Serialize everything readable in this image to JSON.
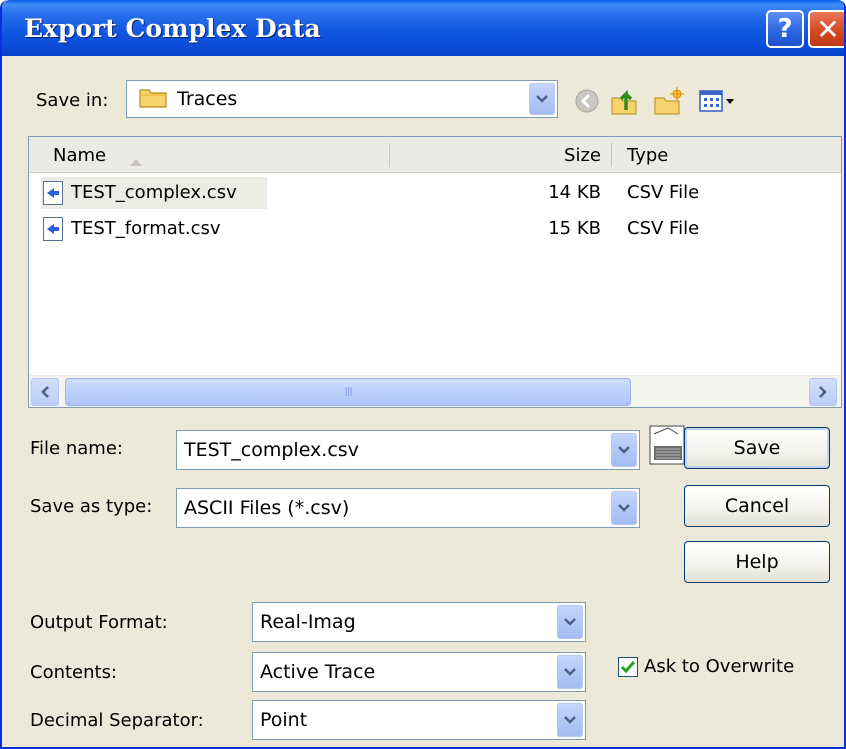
{
  "window": {
    "title": "Export Complex Data",
    "help_glyph": "?",
    "close_glyph": "✕"
  },
  "save_in": {
    "label": "Save in:",
    "value": "Traces"
  },
  "file_list": {
    "columns": [
      "Name",
      "Size",
      "Type"
    ],
    "rows": [
      {
        "name": "TEST_complex.csv",
        "size": "14 KB",
        "type": "CSV File"
      },
      {
        "name": "TEST_format.csv",
        "size": "15 KB",
        "type": "CSV File"
      }
    ],
    "scroll_grip": "III"
  },
  "file_name": {
    "label": "File name:",
    "value": "TEST_complex.csv"
  },
  "save_as_type": {
    "label": "Save as type:",
    "value": "ASCII Files (*.csv)"
  },
  "buttons": {
    "save": "Save",
    "cancel": "Cancel",
    "help": "Help"
  },
  "output_format": {
    "label": "Output Format:",
    "value": "Real-Imag"
  },
  "contents": {
    "label": "Contents:",
    "value": "Active Trace"
  },
  "decimal_separator": {
    "label": "Decimal Separator:",
    "value": "Point"
  },
  "ask_overwrite": {
    "label": "Ask to Overwrite",
    "checked": true
  },
  "icons": {
    "back": "back-arrow-icon",
    "up": "up-folder-icon",
    "new_folder": "new-folder-icon",
    "views": "views-menu-icon",
    "folder": "folder-icon",
    "file": "csv-file-icon",
    "calculator": "calculator-icon"
  },
  "colors": {
    "title_bar": "#0A4BD6",
    "dialog_bg": "#ECE9D8",
    "close_button": "#D3461F",
    "help_button": "#2A63E0"
  }
}
